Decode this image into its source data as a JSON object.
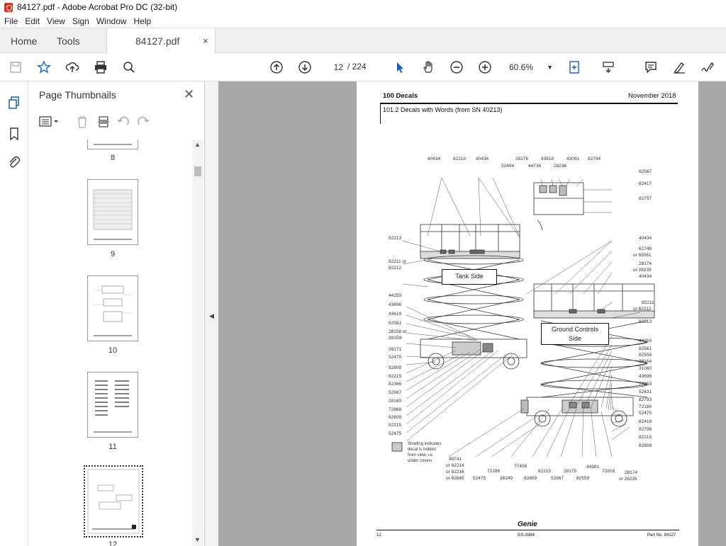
{
  "window": {
    "title": "84127.pdf - Adobe Acrobat Pro DC (32-bit)"
  },
  "menu": [
    "File",
    "Edit",
    "View",
    "Sign",
    "Window",
    "Help"
  ],
  "tabs": {
    "home": "Home",
    "tools": "Tools",
    "document": "84127.pdf",
    "close": "×"
  },
  "toolbar": {
    "page_current": "12",
    "page_total": "/ 224",
    "zoom": "60.6%"
  },
  "panel": {
    "title": "Page Thumbnails",
    "close": "✕",
    "thumbnails": [
      "8",
      "9",
      "10",
      "11",
      "12"
    ],
    "selected": "12"
  },
  "document": {
    "header_left": "100 Decals",
    "header_right": "November 2018",
    "section_title": "101.2 Decals with Words (from SN 40213)",
    "label_tank_side": "Tank Side",
    "label_ground_controls": "Ground Controls",
    "label_ground_controls_2": "Side",
    "shading_note": [
      "Shading indicates",
      "decal is hidden",
      "from view, i.e.",
      "under covers"
    ],
    "top_callouts": [
      "40434",
      "82210",
      "40434",
      "28176",
      "43618",
      "43091",
      "82794",
      "52494",
      "44736",
      "28236"
    ],
    "right_callouts": [
      "82567",
      "82417",
      "82757",
      "40434",
      "62748",
      "or 65061",
      "28174",
      "or 28235",
      "40434",
      "82211",
      "or 82212",
      "82213",
      "44255",
      "82561",
      "82558",
      "28164",
      "31060",
      "43696",
      "72853",
      "52431",
      "82793",
      "72186",
      "52475",
      "82418",
      "82798",
      "82215",
      "82809"
    ],
    "left_callouts": [
      "82213",
      "82211 or",
      "82212",
      "44255",
      "43696",
      "43619",
      "82561",
      "28158 or",
      "28159",
      "28171",
      "52475",
      "82809",
      "82215",
      "82366",
      "52967",
      "28160",
      "72868",
      "82809",
      "82215",
      "52475"
    ],
    "bottom_callouts": [
      "49741",
      "or 82214",
      "or 82216",
      "or 82645",
      "52475",
      "72186",
      "38149",
      "77406",
      "82809",
      "82215",
      "28175",
      "52967",
      "44981",
      "82559",
      "72818",
      "28174",
      "or 28235"
    ],
    "footer_page": "12",
    "footer_brand": "Genie",
    "footer_model": "GS-3384",
    "footer_part": "Part No. 84127"
  }
}
